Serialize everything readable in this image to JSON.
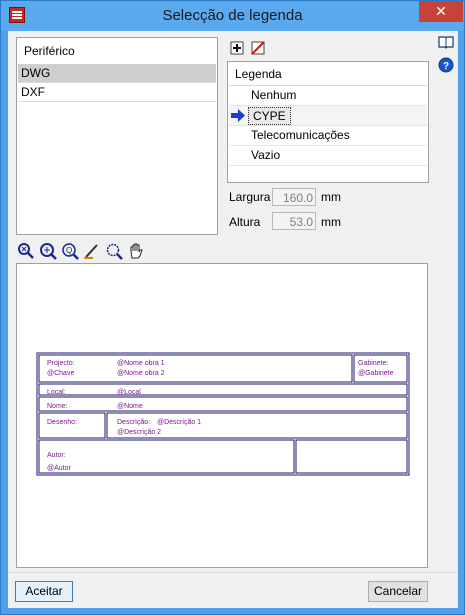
{
  "window": {
    "title": "Selecção de legenda",
    "close_glyph": "✕"
  },
  "device": {
    "header": "Periférico",
    "items": [
      {
        "label": "DWG",
        "selected": true
      },
      {
        "label": "DXF",
        "selected": false
      }
    ]
  },
  "legend": {
    "header": "Legenda",
    "items": [
      {
        "label": "Nenhum",
        "selected": false
      },
      {
        "label": "CYPE",
        "selected": true
      },
      {
        "label": "Telecomunicações",
        "selected": false
      },
      {
        "label": "Vazio",
        "selected": false
      }
    ],
    "add_icon": "add-icon",
    "delete_icon": "delete-icon"
  },
  "dimensions": {
    "width_label": "Largura",
    "width_value": "160.0",
    "width_unit": "mm",
    "height_label": "Altura",
    "height_value": "53.0",
    "height_unit": "mm"
  },
  "preview_tools": [
    "zoom-extents-icon",
    "zoom-window-icon",
    "zoom-icon",
    "pen-icon",
    "zoom-out-icon",
    "pan-hand-icon"
  ],
  "legend_preview": {
    "line_color": "#1a1a6e",
    "text_color": "#7a1a8a",
    "projecto_label": "Projecto:",
    "projecto_obra1": "@Nome obra 1",
    "projecto_obra2": "@Nome obra 2",
    "chave": "@Chave",
    "gabinete_label": "Gabinete:",
    "gabinete_value": "@Gabinete",
    "local_label": "Local:",
    "local_value": "@Local",
    "nome_label": "Nome:",
    "nome_value": "@Nome",
    "desenho_label": "Desenho:",
    "descricao_label": "Descrição:",
    "descricao1": "@Descrição 1",
    "descricao2": "@Descrição 2",
    "autor_label": "Autor:",
    "autor_value": "@Autor"
  },
  "buttons": {
    "accept": "Aceitar",
    "cancel": "Cancelar"
  },
  "side_icons": [
    "help-book-icon",
    "help-info-icon"
  ]
}
